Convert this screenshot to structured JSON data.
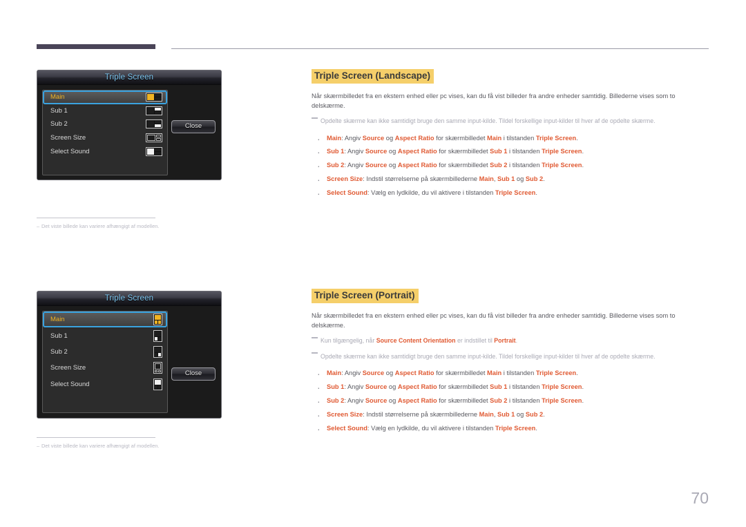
{
  "page": {
    "number": "70"
  },
  "panels": [
    {
      "title": "Triple Screen",
      "close_label": "Close",
      "rows": [
        {
          "label": "Main",
          "icon": "layout-icon-main",
          "selected": true
        },
        {
          "label": "Sub 1",
          "icon": "layout-icon-sub1",
          "selected": false
        },
        {
          "label": "Sub 2",
          "icon": "layout-icon-sub2",
          "selected": false
        },
        {
          "label": "Screen Size",
          "icon": "layout-icon-screen-size",
          "selected": false
        },
        {
          "label": "Select Sound",
          "icon": "layout-icon-select-sound",
          "selected": false
        }
      ],
      "caption": "Det viste billede kan variere afhængigt af modellen."
    },
    {
      "title": "Triple Screen",
      "close_label": "Close",
      "rows": [
        {
          "label": "Main",
          "icon": "layout-icon-main",
          "selected": true
        },
        {
          "label": "Sub 1",
          "icon": "layout-icon-sub1",
          "selected": false
        },
        {
          "label": "Sub 2",
          "icon": "layout-icon-sub2",
          "selected": false
        },
        {
          "label": "Screen Size",
          "icon": "layout-icon-screen-size",
          "selected": false
        },
        {
          "label": "Select Sound",
          "icon": "layout-icon-select-sound",
          "selected": false
        }
      ],
      "caption": "Det viste billede kan variere afhængigt af modellen."
    }
  ],
  "sections": [
    {
      "heading": "Triple Screen (Landscape)",
      "intro": "Når skærmbilledet fra en ekstern enhed eller pc vises, kan du få vist billeder fra andre enheder samtidig. Billederne vises som to delskærme.",
      "notes": [
        {
          "text_before": "Opdelte skærme kan ikke samtidigt bruge den samme input-kilde. Tildel forskellige input-kilder til hver af de opdelte skærme."
        }
      ],
      "bullets": [
        {
          "term": "Main",
          "t1": ": Angiv ",
          "b1": "Source",
          "t2": " og ",
          "b2": "Aspect Ratio",
          "t3": " for skærmbilledet ",
          "b3": "Main",
          "t4": " i tilstanden ",
          "b4": "Triple Screen",
          "t5": "."
        },
        {
          "term": "Sub 1",
          "t1": ": Angiv ",
          "b1": "Source",
          "t2": " og ",
          "b2": "Aspect Ratio",
          "t3": " for skærmbilledet ",
          "b3": "Sub 1",
          "t4": " i tilstanden ",
          "b4": "Triple Screen",
          "t5": "."
        },
        {
          "term": "Sub 2",
          "t1": ": Angiv ",
          "b1": "Source",
          "t2": " og ",
          "b2": "Aspect Ratio",
          "t3": " for skærmbilledet ",
          "b3": "Sub 2",
          "t4": " i tilstanden ",
          "b4": "Triple Screen",
          "t5": "."
        },
        {
          "term": "Screen Size",
          "t1": ": Indstil størrelserne på skærmbillederne ",
          "b1": "Main",
          "t2": ", ",
          "b2": "Sub 1",
          "t3": " og ",
          "b3": "Sub 2",
          "t4": "",
          "b4": "",
          "t5": "."
        },
        {
          "term": "Select Sound",
          "t1": ": Vælg en lydkilde, du vil aktivere i tilstanden ",
          "b1": "Triple Screen",
          "t2": "",
          "b2": "",
          "t3": "",
          "b3": "",
          "t4": "",
          "b4": "",
          "t5": "."
        }
      ]
    },
    {
      "heading": "Triple Screen (Portrait)",
      "intro": "Når skærmbilledet fra en ekstern enhed eller pc vises, kan du få vist billeder fra andre enheder samtidig. Billederne vises som to delskærme.",
      "notes": [
        {
          "pre": "Kun tilgængelig, når ",
          "bold1": "Source Content Orientation",
          "mid": " er indstillet til ",
          "bold2": "Portrait",
          "post": "."
        },
        {
          "text_before": "Opdelte skærme kan ikke samtidigt bruge den samme input-kilde. Tildel forskellige input-kilder til hver af de opdelte skærme."
        }
      ],
      "bullets": [
        {
          "term": "Main",
          "t1": ": Angiv ",
          "b1": "Source",
          "t2": " og ",
          "b2": "Aspect Ratio",
          "t3": " for skærmbilledet ",
          "b3": "Main",
          "t4": " i tilstanden ",
          "b4": "Triple Screen",
          "t5": "."
        },
        {
          "term": "Sub 1",
          "t1": ": Angiv ",
          "b1": "Source",
          "t2": " og ",
          "b2": "Aspect Ratio",
          "t3": " for skærmbilledet ",
          "b3": "Sub 1",
          "t4": " i tilstanden ",
          "b4": "Triple Screen",
          "t5": "."
        },
        {
          "term": "Sub 2",
          "t1": ": Angiv ",
          "b1": "Source",
          "t2": " og ",
          "b2": "Aspect Ratio",
          "t3": " for skærmbilledet ",
          "b3": "Sub 2",
          "t4": " i tilstanden ",
          "b4": "Triple Screen",
          "t5": "."
        },
        {
          "term": "Screen Size",
          "t1": ": Indstil størrelserne på skærmbillederne ",
          "b1": "Main",
          "t2": ", ",
          "b2": "Sub 1",
          "t3": " og ",
          "b3": "Sub 2",
          "t4": "",
          "b4": "",
          "t5": "."
        },
        {
          "term": "Select Sound",
          "t1": ": Vælg en lydkilde, du vil aktivere i tilstanden ",
          "b1": "Triple Screen",
          "t2": "",
          "b2": "",
          "t3": "",
          "b3": "",
          "t4": "",
          "b4": "",
          "t5": "."
        }
      ]
    }
  ],
  "colors": {
    "highlight": "#f5cf6a",
    "accent_orange": "#e05a33",
    "osd_selected_border": "#3aa3e0",
    "osd_title_text": "#7ec8f2",
    "osd_main_yellow": "#f0b323",
    "header_bar": "#4a4458"
  }
}
